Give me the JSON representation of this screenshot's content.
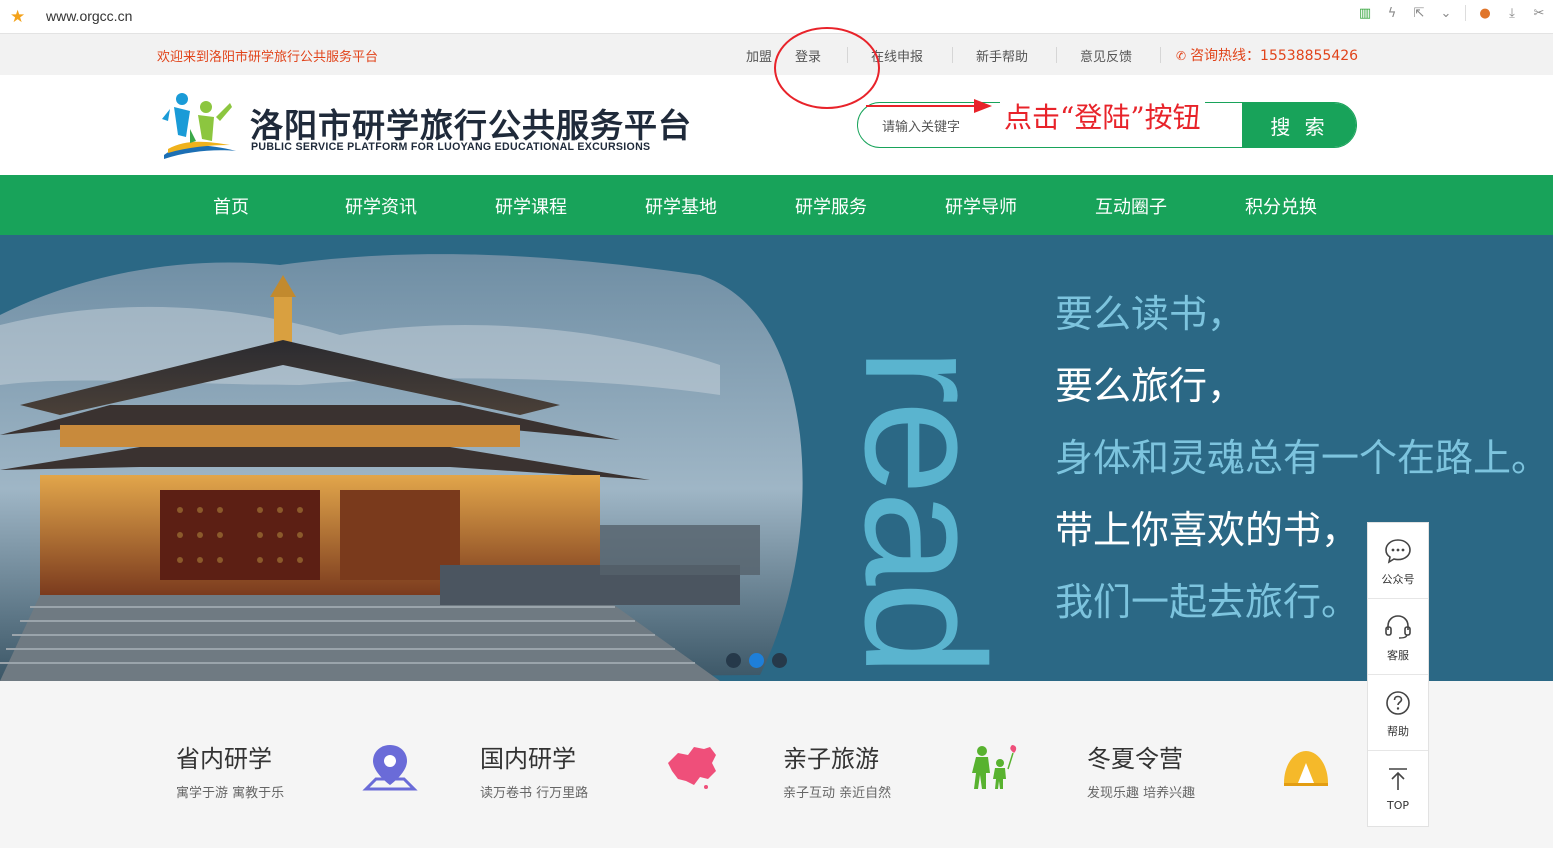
{
  "browser": {
    "url": "www.orgcc.cn"
  },
  "topbar": {
    "welcome": "欢迎来到洛阳市研学旅行公共服务平台",
    "links": [
      "加盟",
      "登录",
      "在线申报",
      "新手帮助",
      "意见反馈"
    ],
    "hotline": "咨询热线：15538855426"
  },
  "header": {
    "logo_cn": "洛阳市研学旅行公共服务平台",
    "logo_en": "PUBLIC SERVICE PLATFORM FOR LUOYANG EDUCATIONAL EXCURSIONS",
    "search_placeholder": "请输入关键字",
    "search_button": "搜 索"
  },
  "annotation": {
    "text": "点击“登陆”按钮",
    "color": "#e8232a"
  },
  "nav": {
    "items": [
      "首页",
      "研学资讯",
      "研学课程",
      "研学基地",
      "研学服务",
      "研学导师",
      "互动圈子",
      "积分兑换"
    ]
  },
  "banner": {
    "vertical_word": "read",
    "lines": [
      "要么读书，",
      "要么旅行，",
      "身体和灵魂总有一个在路上。",
      "带上你喜欢的书，",
      "我们一起去旅行。"
    ],
    "active_slide": 2,
    "slide_count": 3
  },
  "features": [
    {
      "title": "省内研学",
      "subtitle": "寓学于游 寓教于乐",
      "icon": "map-pin-icon"
    },
    {
      "title": "国内研学",
      "subtitle": "读万卷书 行万里路",
      "icon": "china-map-icon"
    },
    {
      "title": "亲子旅游",
      "subtitle": "亲子互动 亲近自然",
      "icon": "family-icon"
    },
    {
      "title": "冬夏令营",
      "subtitle": "发现乐趣 培养兴趣",
      "icon": "tent-icon"
    }
  ],
  "side": {
    "items": [
      "公众号",
      "客服",
      "帮助",
      "TOP"
    ]
  },
  "colors": {
    "brand_green": "#18a35a",
    "accent_red": "#e1441b",
    "banner_bg": "#2b6885"
  }
}
